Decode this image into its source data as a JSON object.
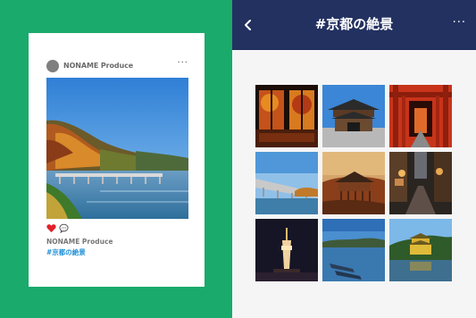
{
  "post": {
    "username": "NONAME Produce",
    "caption_user": "NONAME Produce",
    "hashtag": "#京都の絶景",
    "more_glyph": "···"
  },
  "hashtag_page": {
    "title": "#京都の絶景",
    "back_glyph": "<",
    "more_glyph": "···"
  },
  "icons": {
    "heart": "heart-icon",
    "comment": "comment-icon",
    "back": "chevron-left-icon",
    "more": "more-icon"
  },
  "colors": {
    "left_bg": "#1aaa6b",
    "topbar": "#233161",
    "heart": "#e0222a",
    "hashtag": "#1e8fd6"
  }
}
